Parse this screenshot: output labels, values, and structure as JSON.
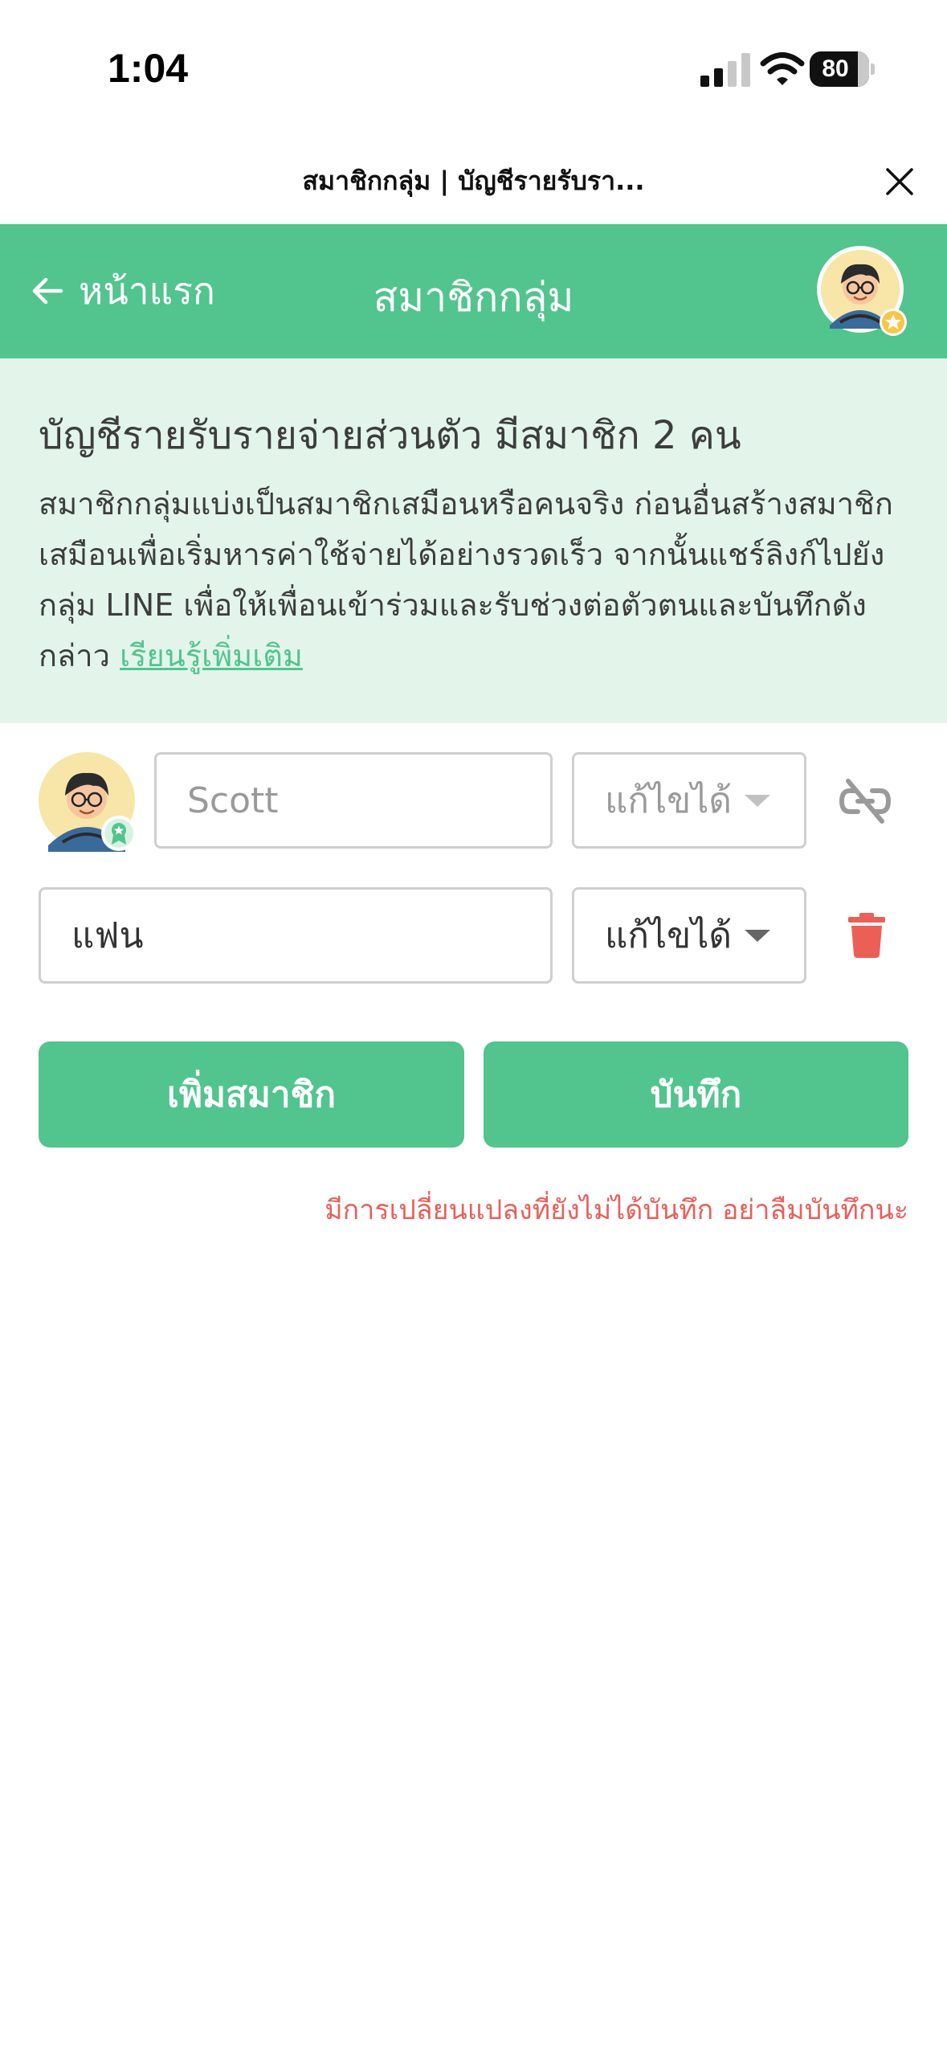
{
  "status_bar": {
    "time": "1:04",
    "battery": "80",
    "battery_level_percent": 80
  },
  "browser": {
    "title": "สมาชิกกลุ่ม | บัญชีรายรับรา..."
  },
  "header": {
    "back_label": "หน้าแรก",
    "title": "สมาชิกกลุ่ม"
  },
  "intro": {
    "title": "บัญชีรายรับรายจ่ายส่วนตัว มีสมาชิก 2 คน",
    "body": "สมาชิกกลุ่มแบ่งเป็นสมาชิกเสมือนหรือคนจริง ก่อนอื่นสร้างสมาชิกเสมือนเพื่อเริ่มหารค่าใช้จ่ายได้อย่างรวดเร็ว จากนั้นแชร์ลิงก์ไปยังกลุ่ม LINE เพื่อให้เพื่อนเข้าร่วมและรับช่วงต่อตัวตนและบันทึกดังกล่าว ",
    "learn_more": "เรียนรู้เพิ่มเติม"
  },
  "members": [
    {
      "name": "Scott",
      "role": "แก้ไขได้",
      "linked": true
    },
    {
      "name": "แฟน",
      "role": "แก้ไขได้",
      "linked": false
    }
  ],
  "actions": {
    "add_member": "เพิ่มสมาชิก",
    "save": "บันทึก"
  },
  "unsaved_warning": "มีการเปลี่ยนแปลงที่ยังไม่ได้บันทึก อย่าลืมบันทึกนะ",
  "colors": {
    "brand_green": "#52c48e",
    "light_green": "#e3f5eb",
    "warning_red": "#e8605b",
    "trash_red": "#ec5f57"
  }
}
